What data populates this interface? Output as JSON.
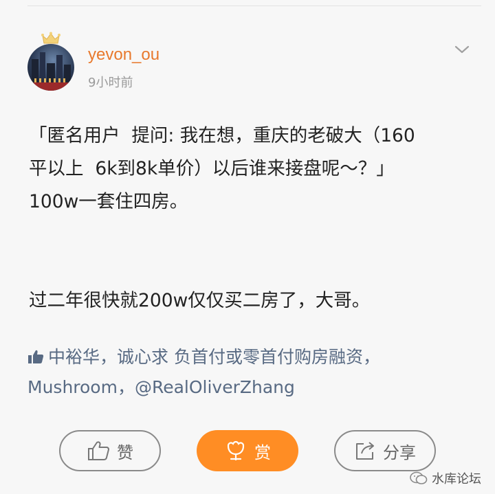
{
  "user": {
    "name": "yevon_ou",
    "time": "9小时前"
  },
  "post": {
    "lines": [
      "「匿名用户  提问: 我在想，重庆的老破大（160",
      "平以上  6k到8k单价）以后谁来接盘呢～？」",
      "100w一套住四房。",
      "过二年很快就200w仅仅买二房了，大哥。"
    ]
  },
  "likes": {
    "line1": "中裕华，诚心求 负首付或零首付购房融资，",
    "line2": "Mushroom，@RealOliverZhang"
  },
  "actions": {
    "like_label": "赞",
    "reward_label": "赏",
    "share_label": "分享"
  },
  "watermark": {
    "text": "水库论坛"
  },
  "colors": {
    "username": "#e8792d",
    "reward_button": "#ff8d24",
    "likes_text": "#586a83"
  }
}
